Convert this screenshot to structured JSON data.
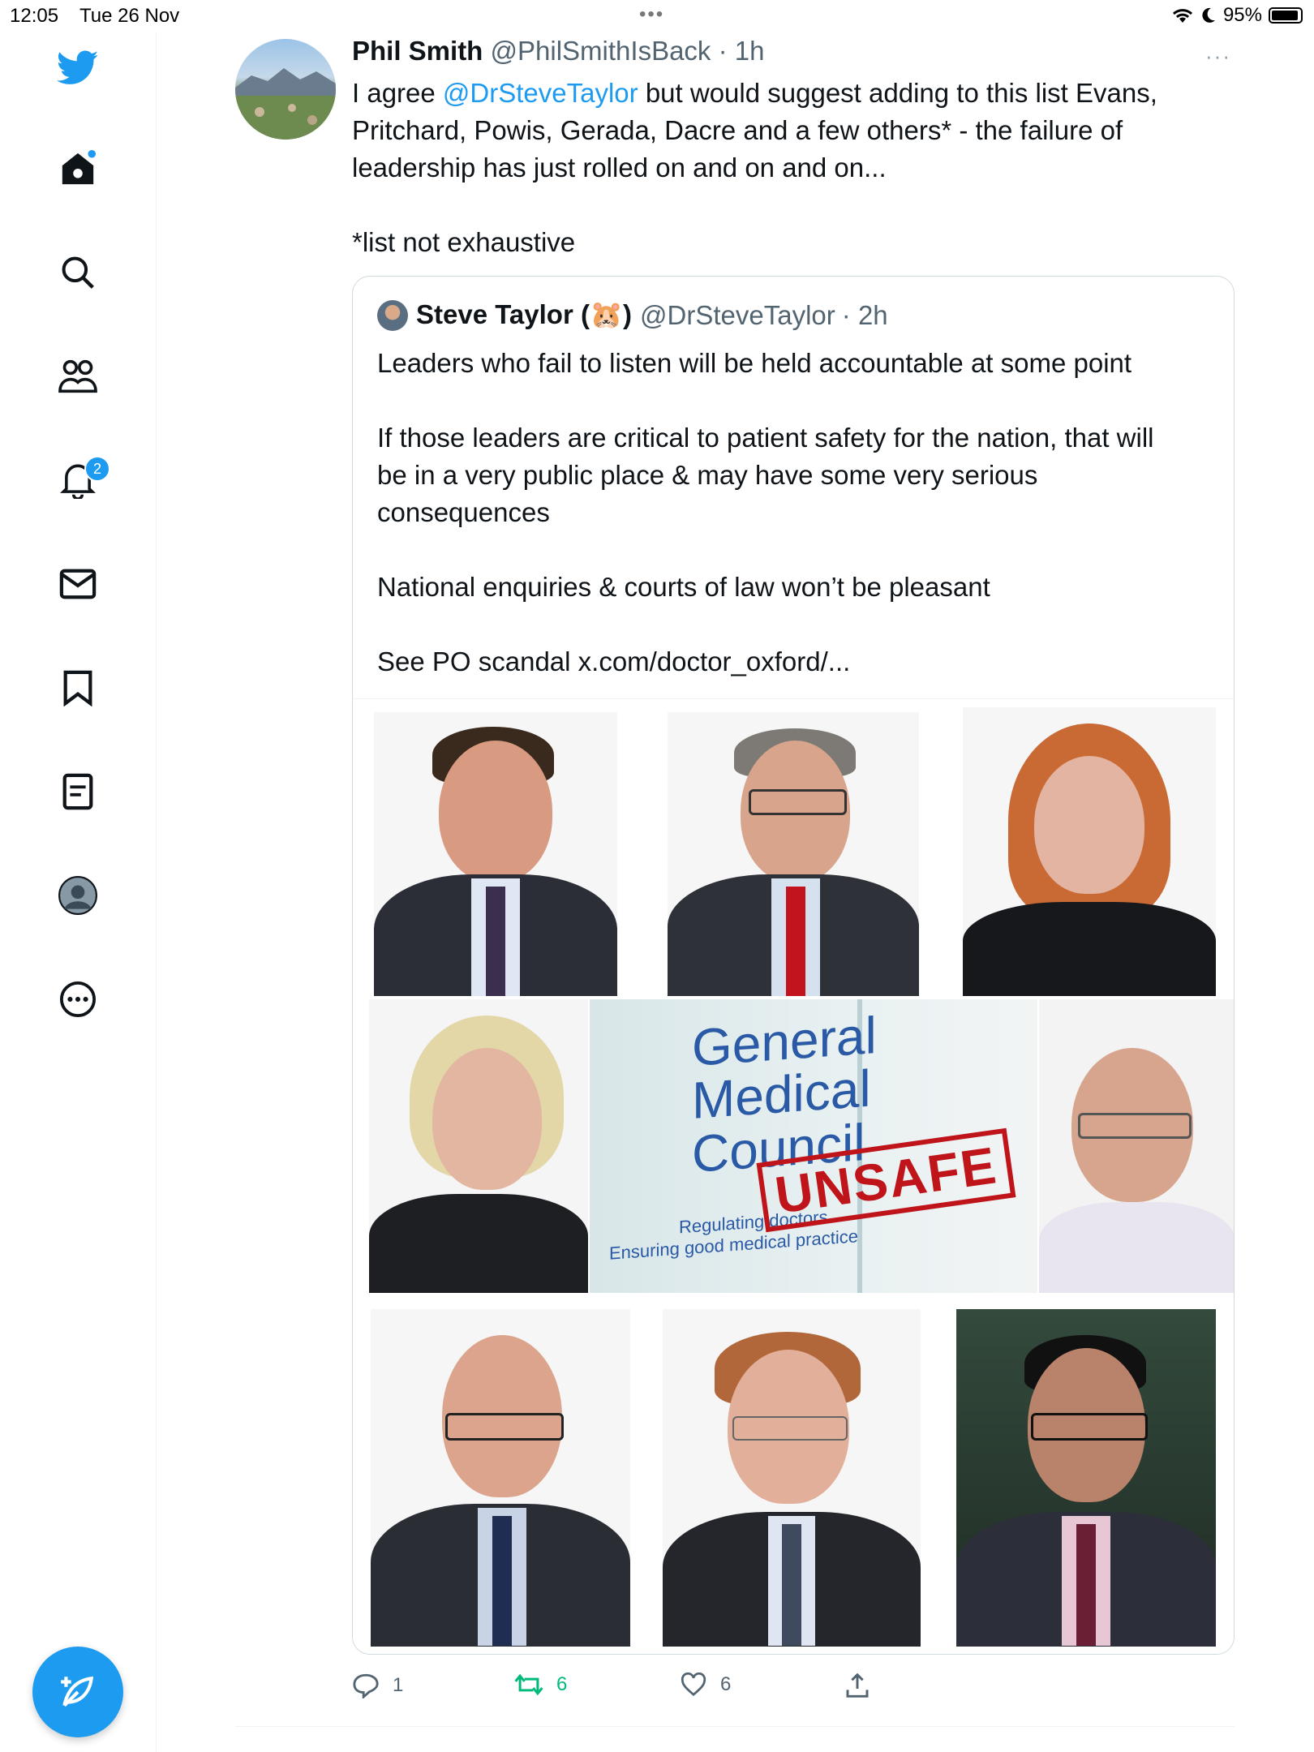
{
  "status": {
    "time": "12:05",
    "date": "Tue 26 Nov",
    "battery": "95%"
  },
  "sidebar": {
    "notifications_count": "2"
  },
  "tweet": {
    "name": "Phil Smith",
    "handle": "@PhilSmithIsBack",
    "time": "· 1h",
    "more": "···",
    "text_line1_before": "I agree ",
    "mention": "@DrSteveTaylor",
    "text_line1_after": " but would suggest adding to this list Evans,",
    "text_line2": "Pritchard, Powis, Gerada, Dacre and a few others* - the failure of",
    "text_line3": "leadership has just rolled on and on and on...",
    "text_line4": "*list not exhaustive"
  },
  "quote": {
    "name": "Steve Taylor (🐹)",
    "handle": "@DrSteveTaylor",
    "time": "· 2h",
    "line1": "Leaders who fail to listen will be held accountable at some point",
    "line2": "If those leaders are critical to patient safety for the nation, that will",
    "line3": "be in a very public place & may have some very serious",
    "line4": "consequences",
    "line5": "National enquiries & courts of law won’t be pleasant",
    "line6": "See PO scandal x.com/doctor_oxford/..."
  },
  "collage": {
    "gmc_line1": "General",
    "gmc_line2": "Medical",
    "gmc_line3": "Council",
    "stamp": "UNSAFE",
    "tagline1": "Regulating doctors",
    "tagline2": "Ensuring good medical practice"
  },
  "actions": {
    "replies": "1",
    "reposts": "6",
    "likes": "6"
  },
  "colors": {
    "accent": "#1d9bf0",
    "repost": "#00ba7c",
    "stamp": "#c0141b"
  }
}
